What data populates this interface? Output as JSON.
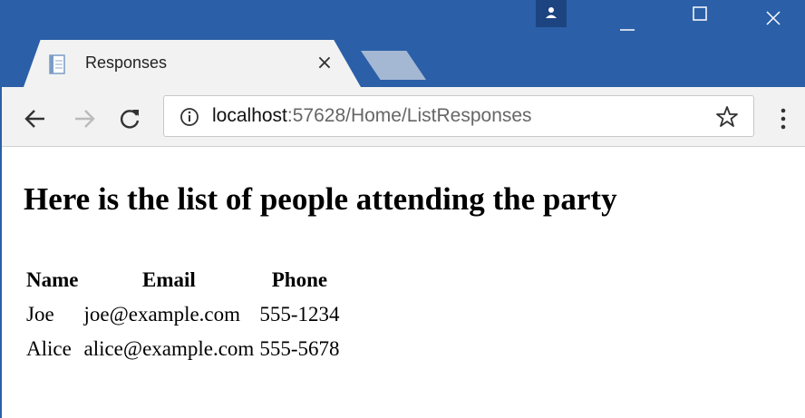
{
  "browser": {
    "tab_title": "Responses",
    "tab_close": "×",
    "url_host": "localhost",
    "url_rest": ":57628/Home/ListResponses",
    "icons": {
      "tab": "page-icon",
      "back": "arrow-left-icon",
      "forward": "arrow-right-icon",
      "reload": "reload-icon",
      "info": "info-icon",
      "bookmark": "star-icon",
      "menu": "three-dots-icon",
      "profile": "person-icon",
      "minimize": "minimize-icon",
      "maximize": "maximize-icon",
      "close": "close-icon"
    },
    "colors": {
      "frame": "#2b5fa8",
      "toolbar": "#f2f2f2",
      "inactive_tab": "#a4b7d3",
      "profile": "#1c4480"
    }
  },
  "page": {
    "heading": "Here is the list of people attending the party",
    "table": {
      "headers": [
        "Name",
        "Email",
        "Phone"
      ],
      "rows": [
        [
          "Joe",
          "joe@example.com",
          "555-1234"
        ],
        [
          "Alice",
          "alice@example.com",
          "555-5678"
        ]
      ]
    }
  }
}
